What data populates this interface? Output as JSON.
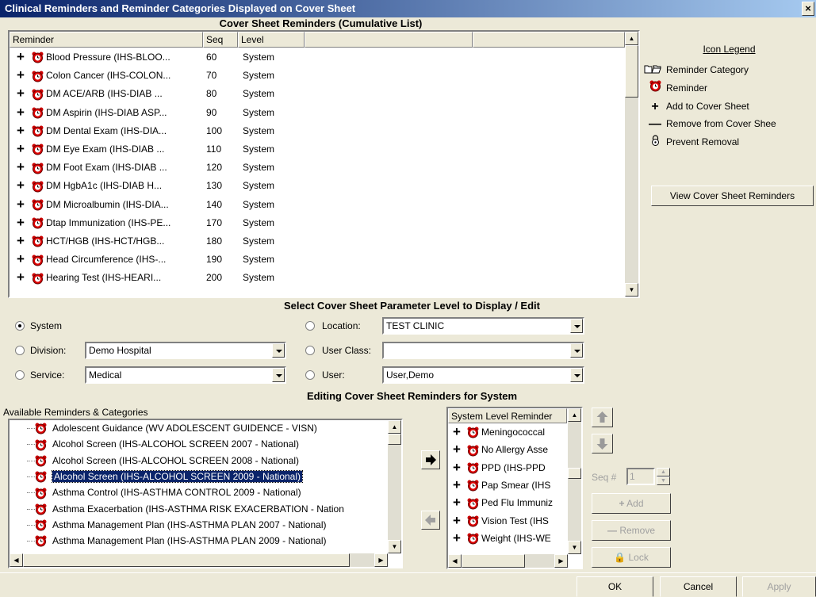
{
  "window": {
    "title": "Clinical Reminders and Reminder Categories Displayed on Cover Sheet",
    "close_glyph": "×"
  },
  "cumulative": {
    "heading": "Cover Sheet Reminders (Cumulative List)",
    "columns": [
      "Reminder",
      "Seq",
      "Level"
    ],
    "rows": [
      {
        "reminder": "Blood Pressure (IHS-BLOO...",
        "seq": "60",
        "level": "System"
      },
      {
        "reminder": "Colon Cancer (IHS-COLON...",
        "seq": "70",
        "level": "System"
      },
      {
        "reminder": "DM ACE/ARB (IHS-DIAB ...",
        "seq": "80",
        "level": "System"
      },
      {
        "reminder": "DM Aspirin (IHS-DIAB ASP...",
        "seq": "90",
        "level": "System"
      },
      {
        "reminder": "DM Dental Exam (IHS-DIA...",
        "seq": "100",
        "level": "System"
      },
      {
        "reminder": "DM Eye Exam (IHS-DIAB ...",
        "seq": "110",
        "level": "System"
      },
      {
        "reminder": "DM Foot Exam (IHS-DIAB ...",
        "seq": "120",
        "level": "System"
      },
      {
        "reminder": "DM HgbA1c (IHS-DIAB H...",
        "seq": "130",
        "level": "System"
      },
      {
        "reminder": "DM Microalbumin (IHS-DIA...",
        "seq": "140",
        "level": "System"
      },
      {
        "reminder": "Dtap Immunization (IHS-PE...",
        "seq": "170",
        "level": "System"
      },
      {
        "reminder": "HCT/HGB (IHS-HCT/HGB...",
        "seq": "180",
        "level": "System"
      },
      {
        "reminder": "Head Circumference (IHS-...",
        "seq": "190",
        "level": "System"
      },
      {
        "reminder": "Hearing Test (IHS-HEARI...",
        "seq": "200",
        "level": "System"
      }
    ]
  },
  "legend": {
    "title": "Icon Legend",
    "items": [
      {
        "icon": "folder-icon",
        "label": "Reminder Category"
      },
      {
        "icon": "reminder-clock-icon",
        "label": "Reminder"
      },
      {
        "icon": "plus-icon",
        "label": "Add to Cover Sheet"
      },
      {
        "icon": "minus-icon",
        "label": "Remove from Cover Shee"
      },
      {
        "icon": "lock-icon",
        "label": "Prevent Removal"
      }
    ],
    "view_button": "View Cover Sheet Reminders"
  },
  "param": {
    "heading": "Select Cover Sheet Parameter Level to Display / Edit",
    "system_label": "System",
    "division_label": "Division:",
    "division_value": "Demo Hospital",
    "service_label": "Service:",
    "service_value": "Medical",
    "location_label": "Location:",
    "location_value": "TEST CLINIC",
    "userclass_label": "User Class:",
    "userclass_value": "",
    "user_label": "User:",
    "user_value": "User,Demo",
    "selected": "System"
  },
  "editing": {
    "heading": "Editing Cover Sheet Reminders for System",
    "available_label": "Available Reminders & Categories",
    "available": [
      "Adolescent Guidance (WV ADOLESCENT GUIDENCE - VISN)",
      "Alcohol Screen (IHS-ALCOHOL SCREEN 2007 - National)",
      "Alcohol Screen (IHS-ALCOHOL SCREEN 2008 - National)",
      "Alcohol Screen (IHS-ALCOHOL SCREEN 2009 - National)",
      "Asthma Control (IHS-ASTHMA CONTROL 2009 - National)",
      "Asthma Exacerbation (IHS-ASTHMA RISK EXACERBATION - Nation",
      "Asthma Management Plan (IHS-ASTHMA PLAN 2007 - National)",
      "Asthma Management Plan (IHS-ASTHMA PLAN 2009 - National)"
    ],
    "selected_index": 3,
    "system_header": "System Level Reminder",
    "system_items": [
      "Meningococcal",
      "No Allergy Asse",
      "PPD (IHS-PPD",
      "Pap Smear (IHS",
      "Ped Flu Immuniz",
      "Vision Test (IHS",
      "Weight (IHS-WE"
    ],
    "seq_label": "Seq #",
    "seq_value": "1",
    "add_button": "Add",
    "remove_button": "Remove",
    "lock_button": "Lock"
  },
  "footer": {
    "ok": "OK",
    "cancel": "Cancel",
    "apply": "Apply"
  },
  "colors": {
    "title_start": "#0a246a",
    "title_end": "#a6caf0",
    "face": "#ece9d8",
    "selection": "#0a246a"
  }
}
